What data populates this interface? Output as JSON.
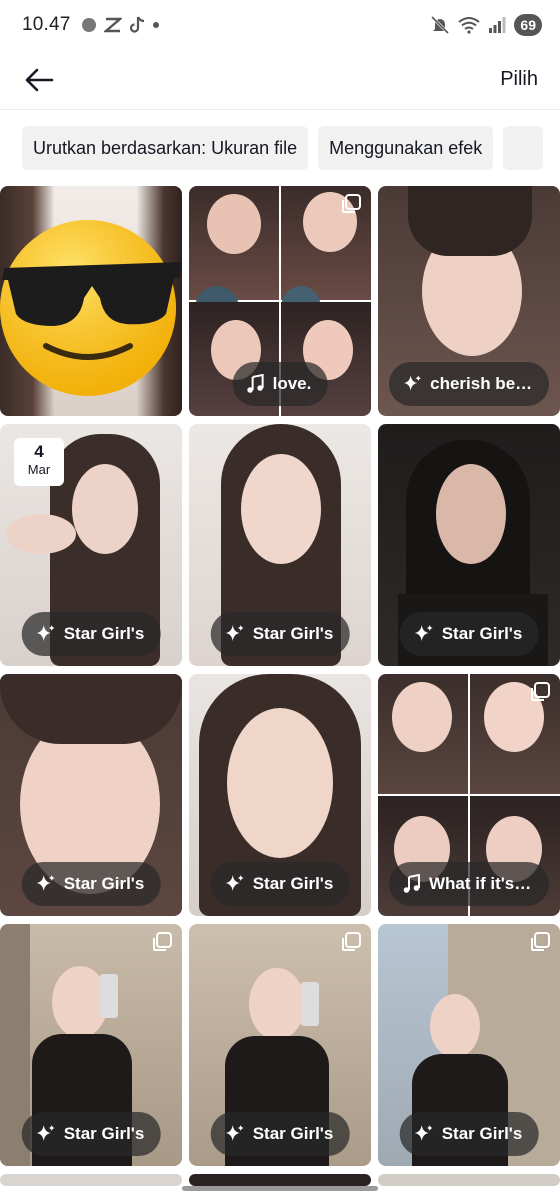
{
  "status_bar": {
    "time": "10.47",
    "battery": "69"
  },
  "header": {
    "select_label": "Pilih"
  },
  "chips": [
    "Urutkan berdasarkan: Ukuran file",
    "Menggunakan efek",
    ""
  ],
  "tiles": [
    {
      "label": "",
      "icon": "emoji-sticker",
      "multi": false
    },
    {
      "label": "love.",
      "icon": "music-note-icon",
      "multi": true
    },
    {
      "label": "cherish berry",
      "icon": "sparkle-icon",
      "multi": false
    },
    {
      "label": "Star Girl's",
      "icon": "sparkle-icon",
      "multi": false,
      "date": {
        "day": "4",
        "month": "Mar"
      }
    },
    {
      "label": "Star Girl's",
      "icon": "sparkle-icon",
      "multi": false
    },
    {
      "label": "Star Girl's",
      "icon": "sparkle-icon",
      "multi": false
    },
    {
      "label": "Star Girl's",
      "icon": "sparkle-icon",
      "multi": false
    },
    {
      "label": "Star Girl's",
      "icon": "sparkle-icon",
      "multi": false
    },
    {
      "label": "What if it's ...",
      "icon": "music-note-icon",
      "multi": true
    },
    {
      "label": "Star Girl's",
      "icon": "sparkle-icon",
      "multi": true
    },
    {
      "label": "Star Girl's",
      "icon": "sparkle-icon",
      "multi": true
    },
    {
      "label": "Star Girl's",
      "icon": "sparkle-icon",
      "multi": true
    }
  ]
}
